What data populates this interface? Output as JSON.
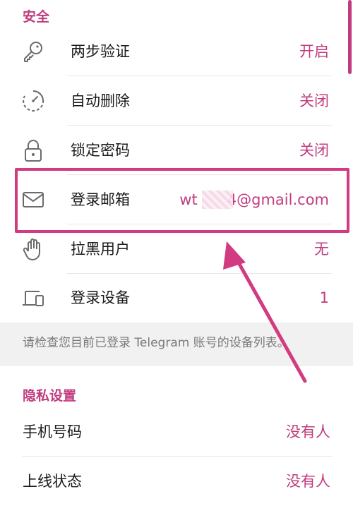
{
  "security": {
    "title": "安全",
    "items": [
      {
        "label": "两步验证",
        "value": "开启",
        "icon": "key-icon"
      },
      {
        "label": "自动删除",
        "value": "关闭",
        "icon": "timer-icon"
      },
      {
        "label": "锁定密码",
        "value": "关闭",
        "icon": "lock-icon"
      },
      {
        "label": "登录邮箱",
        "value": "wt  4@gmail.com",
        "icon": "mail-icon"
      },
      {
        "label": "拉黑用户",
        "value": "无",
        "icon": "hand-icon"
      },
      {
        "label": "登录设备",
        "value": "1",
        "icon": "devices-icon"
      }
    ],
    "footer": "请检查您目前已登录 Telegram 账号的设备列表。"
  },
  "privacy": {
    "title": "隐私设置",
    "items": [
      {
        "label": "手机号码",
        "value": "没有人"
      },
      {
        "label": "上线状态",
        "value": "没有人"
      }
    ]
  },
  "colors": {
    "accent": "#c13c7e",
    "annotation": "#d23b81"
  }
}
